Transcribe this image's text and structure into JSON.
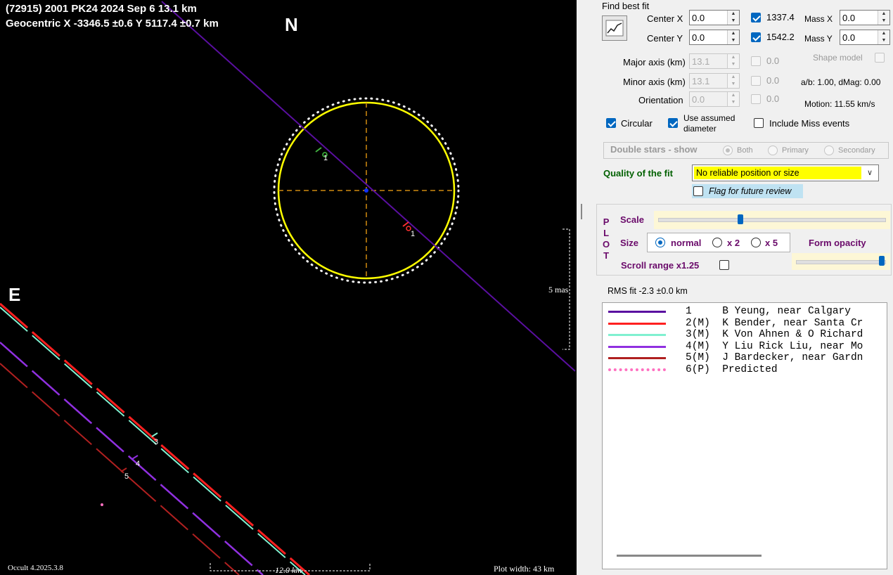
{
  "plot": {
    "header_line1": "(72915) 2001 PK24  2024 Sep 6   13.1 km",
    "header_line2": "Geocentric  X  -3346.5 ±0.6  Y 5117.4 ±0.7 km",
    "north_label": "N",
    "east_label": "E",
    "scale_mas_label": "5 mas",
    "version_label": "Occult 4.2025.3.8",
    "plot_width_label": "Plot width: 43 km",
    "scale_km_label": "12.0 km",
    "chord_labels": [
      "1",
      "1",
      "3",
      "4",
      "5"
    ],
    "colors": {
      "ellipse": "#ffff00",
      "axes": "#d08a10",
      "background": "#000000"
    }
  },
  "panel": {
    "find_best_fit_label": "Find best fit",
    "center_x_label": "Center X",
    "center_x_value": "0.0",
    "center_y_label": "Center Y",
    "center_y_value": "0.0",
    "center_x_cb_value": "1337.4",
    "center_y_cb_value": "1542.2",
    "mass_x_label": "Mass X",
    "mass_x_value": "0.0",
    "mass_y_label": "Mass Y",
    "mass_y_value": "0.0",
    "major_axis_label": "Major axis (km)",
    "major_axis_value": "13.1",
    "minor_axis_label": "Minor axis (km)",
    "minor_axis_value": "13.1",
    "orientation_label": "Orientation",
    "orientation_value": "0.0",
    "major_cb_value": "0.0",
    "minor_cb_value": "0.0",
    "orient_cb_value": "0.0",
    "shape_model_label": "Shape model",
    "ab_dmag_label": "a/b: 1.00, dMag: 0.00",
    "motion_label": "Motion: 11.55 km/s",
    "circular_label": "Circular",
    "use_assumed_line1": "Use assumed",
    "use_assumed_line2": "diameter",
    "include_miss_label": "Include Miss events",
    "double_stars_label": "Double stars - show",
    "both_label": "Both",
    "primary_label": "Primary",
    "secondary_label": "Secondary",
    "quality_label": "Quality of the fit",
    "quality_value": "No reliable position or size",
    "flag_review_label": "Flag for future review",
    "plot_vertical_label": [
      "P",
      "L",
      "O",
      "T"
    ],
    "scale_label": "Scale",
    "size_label": "Size",
    "normal_label": "normal",
    "x2_label": "x 2",
    "x5_label": "x 5",
    "form_opacity_label": "Form opacity",
    "scroll_range_label": "Scroll range x1.25",
    "scale_slider_fraction": 0.36,
    "opacity_slider_fraction": 1.0,
    "rms_label": "RMS fit -2.3 ±0.0 km"
  },
  "legend": [
    {
      "text": "1     B Yeung, near Calgary",
      "color": "#5a0fa0",
      "style": "solid"
    },
    {
      "text": "2(M)  K Bender, near Santa Cr",
      "color": "#ff2020",
      "style": "solid"
    },
    {
      "text": "3(M)  K Von Ahnen & O Richard",
      "color": "#80f0d0",
      "style": "solid"
    },
    {
      "text": "4(M)  Y Liu Rick Liu, near Mo",
      "color": "#9030e0",
      "style": "solid"
    },
    {
      "text": "5(M)  J Bardecker, near Gardn",
      "color": "#b02020",
      "style": "solid"
    },
    {
      "text": "6(P)  Predicted",
      "color": "#ff70c0",
      "style": "dotted"
    }
  ]
}
